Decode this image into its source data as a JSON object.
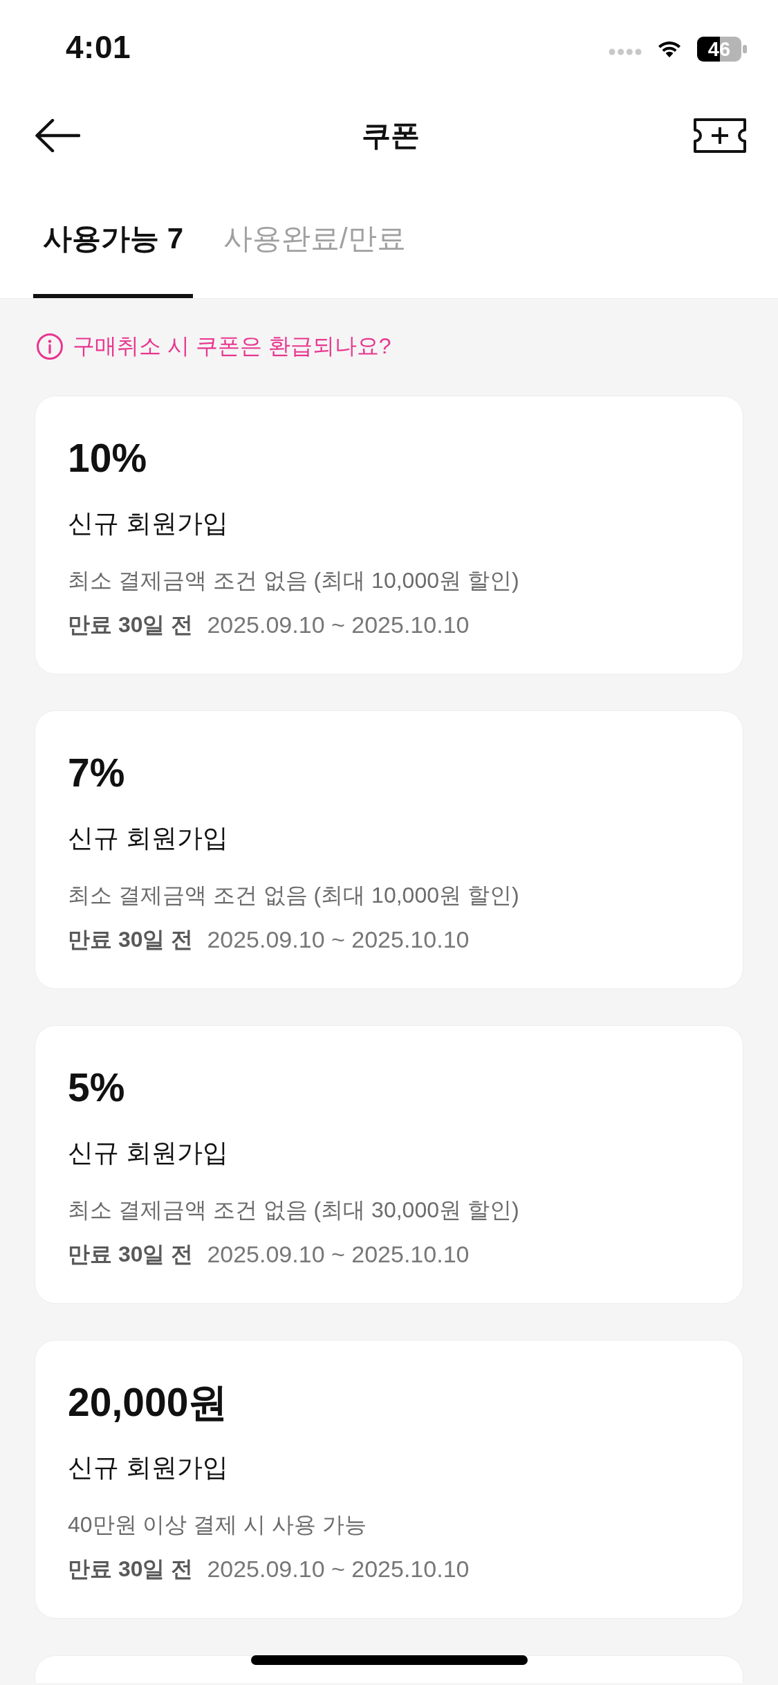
{
  "status_bar": {
    "time": "4:01",
    "battery": "46"
  },
  "header": {
    "title": "쿠폰"
  },
  "tabs": [
    {
      "label": "사용가능 7",
      "selected": true
    },
    {
      "label": "사용완료/만료",
      "selected": false
    }
  ],
  "notice": {
    "text": "구매취소 시 쿠폰은 환급되나요?"
  },
  "coupons": [
    {
      "amount": "10%",
      "name": "신규 회원가입",
      "condition": "최소 결제금액 조건 없음 (최대 10,000원 할인)",
      "expiry": "만료 30일 전",
      "period": "2025.09.10 ~ 2025.10.10"
    },
    {
      "amount": "7%",
      "name": "신규 회원가입",
      "condition": "최소 결제금액 조건 없음 (최대 10,000원 할인)",
      "expiry": "만료 30일 전",
      "period": "2025.09.10 ~ 2025.10.10"
    },
    {
      "amount": "5%",
      "name": "신규 회원가입",
      "condition": "최소 결제금액 조건 없음 (최대 30,000원 할인)",
      "expiry": "만료 30일 전",
      "period": "2025.09.10 ~ 2025.10.10"
    },
    {
      "amount": "20,000원",
      "name": "신규 회원가입",
      "condition": "40만원 이상 결제 시 사용 가능",
      "expiry": "만료 30일 전",
      "period": "2025.09.10 ~ 2025.10.10"
    }
  ]
}
